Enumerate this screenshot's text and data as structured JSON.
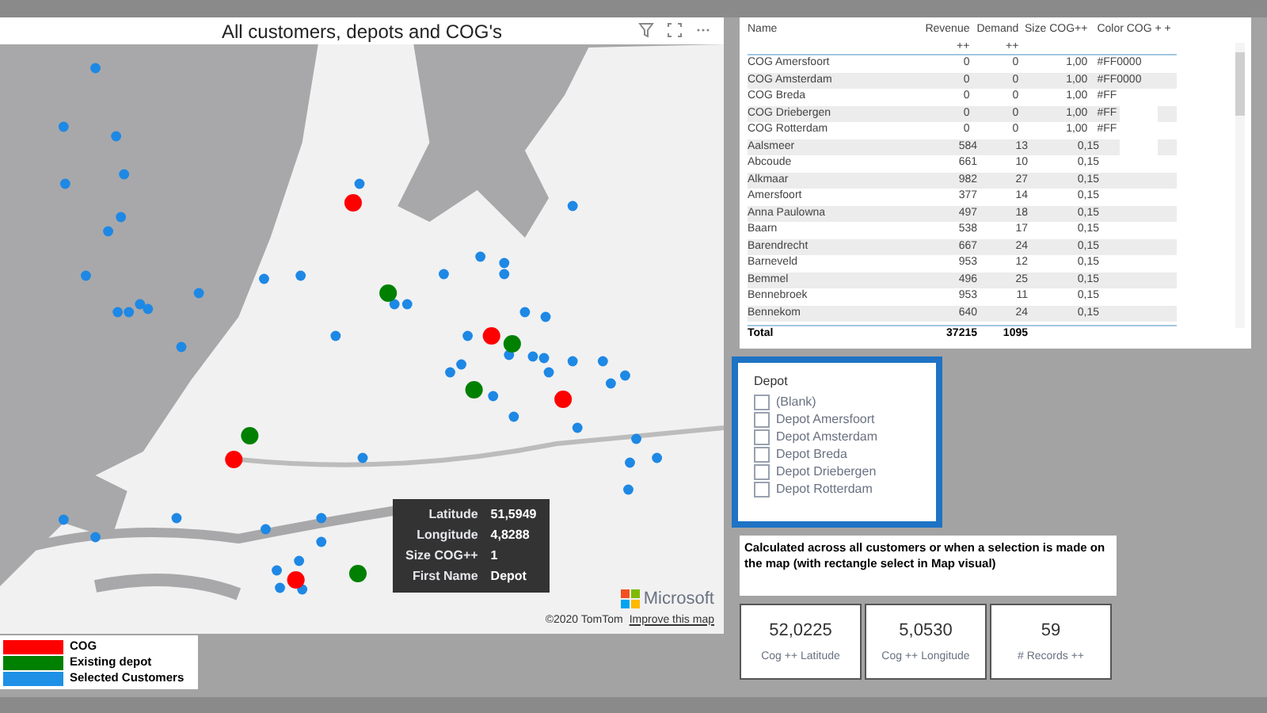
{
  "map": {
    "title": "All customers, depots and COG's",
    "tooltip": [
      {
        "label": "Latitude",
        "value": "51,5949"
      },
      {
        "label": "Longitude",
        "value": "4,8288"
      },
      {
        "label": "Size COG++",
        "value": "1"
      },
      {
        "label": "First Name",
        "value": "Depot"
      }
    ],
    "attribution": "©2020 TomTom",
    "improve_link": "Improve this map",
    "brand": "Microsoft"
  },
  "legend": [
    {
      "label": "COG",
      "color": "#ff0000"
    },
    {
      "label": "Existing depot",
      "color": "#008000"
    },
    {
      "label": "Selected Customers",
      "color": "#1e90e6"
    }
  ],
  "table": {
    "columns": [
      "Name",
      "Revenue ++",
      "Demand ++",
      "Size COG++",
      "Color COG + +"
    ],
    "rows": [
      [
        "COG Amersfoort",
        "0",
        "0",
        "1,00",
        "#FF0000"
      ],
      [
        "COG Amsterdam",
        "0",
        "0",
        "1,00",
        "#FF0000"
      ],
      [
        "COG Breda",
        "0",
        "0",
        "1,00",
        "#FF"
      ],
      [
        "COG Driebergen",
        "0",
        "0",
        "1,00",
        "#FF"
      ],
      [
        "COG Rotterdam",
        "0",
        "0",
        "1,00",
        "#FF"
      ],
      [
        "Aalsmeer",
        "584",
        "13",
        "0,15",
        ""
      ],
      [
        "Abcoude",
        "661",
        "10",
        "0,15",
        ""
      ],
      [
        "Alkmaar",
        "982",
        "27",
        "0,15",
        ""
      ],
      [
        "Amersfoort",
        "377",
        "14",
        "0,15",
        ""
      ],
      [
        "Anna Paulowna",
        "497",
        "18",
        "0,15",
        ""
      ],
      [
        "Baarn",
        "538",
        "17",
        "0,15",
        ""
      ],
      [
        "Barendrecht",
        "667",
        "24",
        "0,15",
        ""
      ],
      [
        "Barneveld",
        "953",
        "12",
        "0,15",
        ""
      ],
      [
        "Bemmel",
        "496",
        "25",
        "0,15",
        ""
      ],
      [
        "Bennebroek",
        "953",
        "11",
        "0,15",
        ""
      ],
      [
        "Bennekom",
        "640",
        "24",
        "0,15",
        ""
      ]
    ],
    "total": [
      "Total",
      "37215",
      "1095"
    ]
  },
  "slicer": {
    "title": "Depot",
    "items": [
      {
        "label": "(Blank)",
        "checked": false
      },
      {
        "label": "Depot Amersfoort",
        "checked": false
      },
      {
        "label": "Depot Amsterdam",
        "checked": false
      },
      {
        "label": "Depot Breda",
        "checked": false
      },
      {
        "label": "Depot Driebergen",
        "checked": false
      },
      {
        "label": "Depot Rotterdam",
        "checked": false
      }
    ]
  },
  "note": "Calculated across all customers or when a selection is made on the map (with rectangle select in Map visual)",
  "cards": [
    {
      "value": "52,0225",
      "label": "Cog ++ Latitude"
    },
    {
      "value": "5,0530",
      "label": "Cog ++ Longitude"
    },
    {
      "value": "59",
      "label": "# Records ++"
    }
  ]
}
